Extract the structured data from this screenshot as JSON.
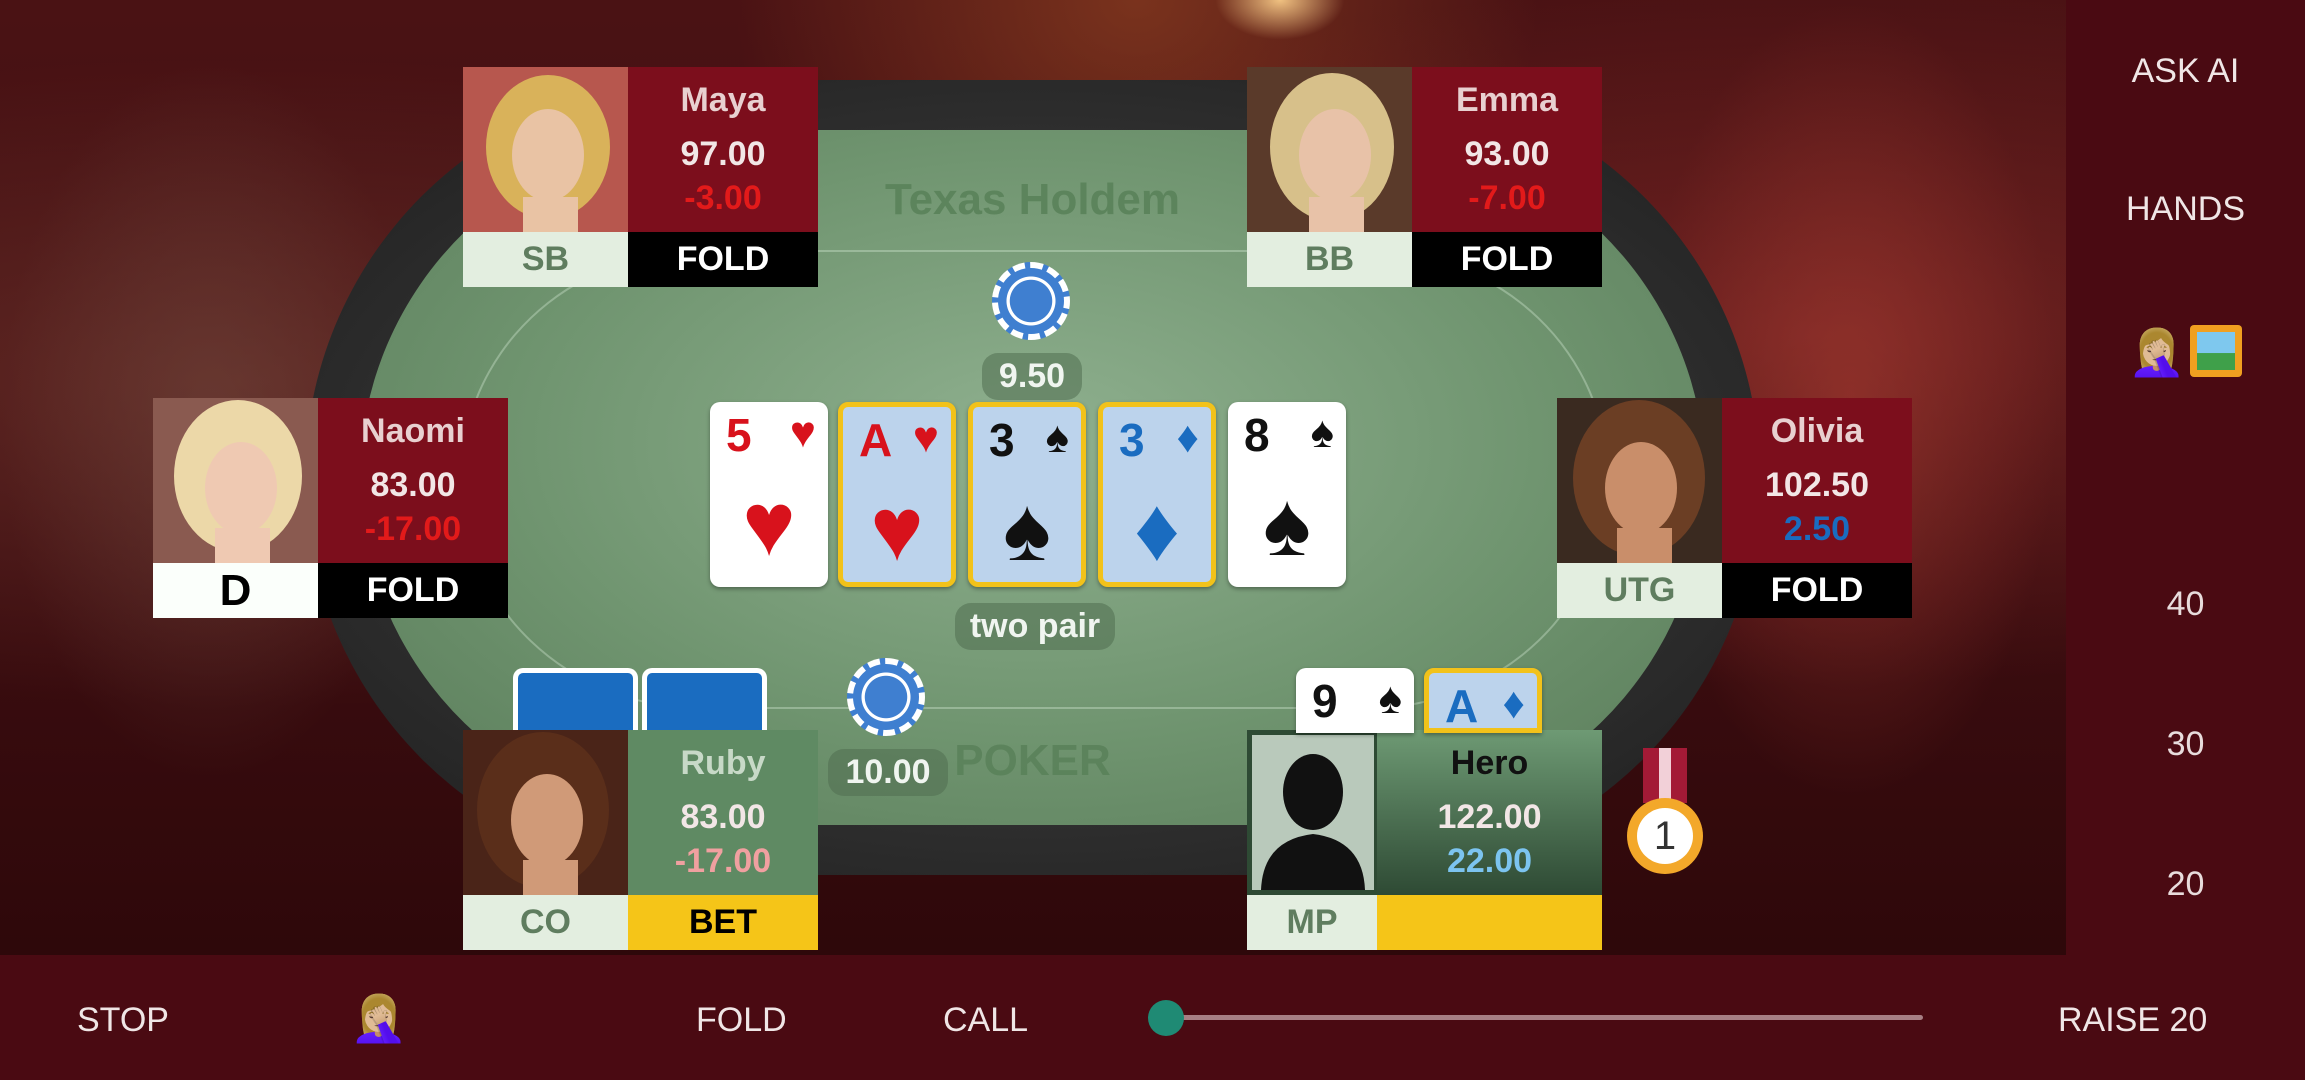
{
  "sidebar": {
    "ask_ai": "ASK AI",
    "hands": "HANDS",
    "emoji_icon": "facepalm-emoji",
    "picture_icon": "framed-picture-emoji",
    "levels": [
      "40",
      "30",
      "20"
    ]
  },
  "table": {
    "title": "Texas Holdem",
    "subtitle": "POKER",
    "pot_top": "9.50",
    "pot_bottom": "10.00",
    "hand_label": "two pair"
  },
  "board": [
    {
      "rank": "5",
      "suit": "♥",
      "color": "#d8121c",
      "highlight": false
    },
    {
      "rank": "A",
      "suit": "♥",
      "color": "#d8121c",
      "highlight": true
    },
    {
      "rank": "3",
      "suit": "♠",
      "color": "#111111",
      "highlight": true
    },
    {
      "rank": "3",
      "suit": "♦",
      "color": "#1a6cc0",
      "highlight": true
    },
    {
      "rank": "8",
      "suit": "♠",
      "color": "#111111",
      "highlight": false
    }
  ],
  "hero_cards": [
    {
      "rank": "9",
      "suit": "♠",
      "color": "#111111",
      "highlight": false
    },
    {
      "rank": "A",
      "suit": "♦",
      "color": "#1a6cc0",
      "highlight": true
    }
  ],
  "players": {
    "maya": {
      "name": "Maya",
      "stack": "97.00",
      "delta": "-3.00",
      "position": "SB",
      "action": "FOLD"
    },
    "emma": {
      "name": "Emma",
      "stack": "93.00",
      "delta": "-7.00",
      "position": "BB",
      "action": "FOLD"
    },
    "naomi": {
      "name": "Naomi",
      "stack": "83.00",
      "delta": "-17.00",
      "position": "D",
      "action": "FOLD"
    },
    "olivia": {
      "name": "Olivia",
      "stack": "102.50",
      "delta": "2.50",
      "position": "UTG",
      "action": "FOLD"
    },
    "ruby": {
      "name": "Ruby",
      "stack": "83.00",
      "delta": "-17.00",
      "position": "CO",
      "action": "BET"
    },
    "hero": {
      "name": "Hero",
      "stack": "122.00",
      "delta": "22.00",
      "position": "MP",
      "action": ""
    }
  },
  "medal": {
    "place": "1"
  },
  "controls": {
    "stop": "STOP",
    "emoji_icon": "facepalm-emoji",
    "fold": "FOLD",
    "call": "CALL",
    "raise": "RAISE 20",
    "slider_fraction": 0.0
  },
  "colors": {
    "accent_gold": "#f2c21a",
    "panel_red": "#7c0e1c",
    "panel_green": "#5f7d5f",
    "loss_red": "#d8121c",
    "gain_blue": "#1a6cc0"
  }
}
